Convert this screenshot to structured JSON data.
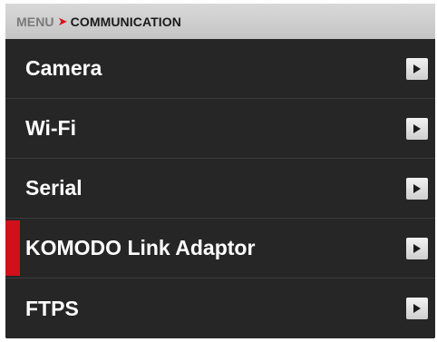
{
  "breadcrumb": {
    "root": "MENU",
    "separator": "➤",
    "current": "COMMUNICATION"
  },
  "menu": {
    "items": [
      {
        "label": "Camera",
        "icon": "chevron-right-icon",
        "selected": false
      },
      {
        "label": "Wi-Fi",
        "icon": "chevron-right-icon",
        "selected": false
      },
      {
        "label": "Serial",
        "icon": "chevron-right-icon",
        "selected": false
      },
      {
        "label": "KOMODO Link Adaptor",
        "icon": "chevron-right-icon",
        "selected": true
      },
      {
        "label": "FTPS",
        "icon": "chevron-right-icon",
        "selected": false
      }
    ]
  },
  "colors": {
    "background": "#262626",
    "accent": "#d0101a",
    "header": "#cccccc"
  }
}
